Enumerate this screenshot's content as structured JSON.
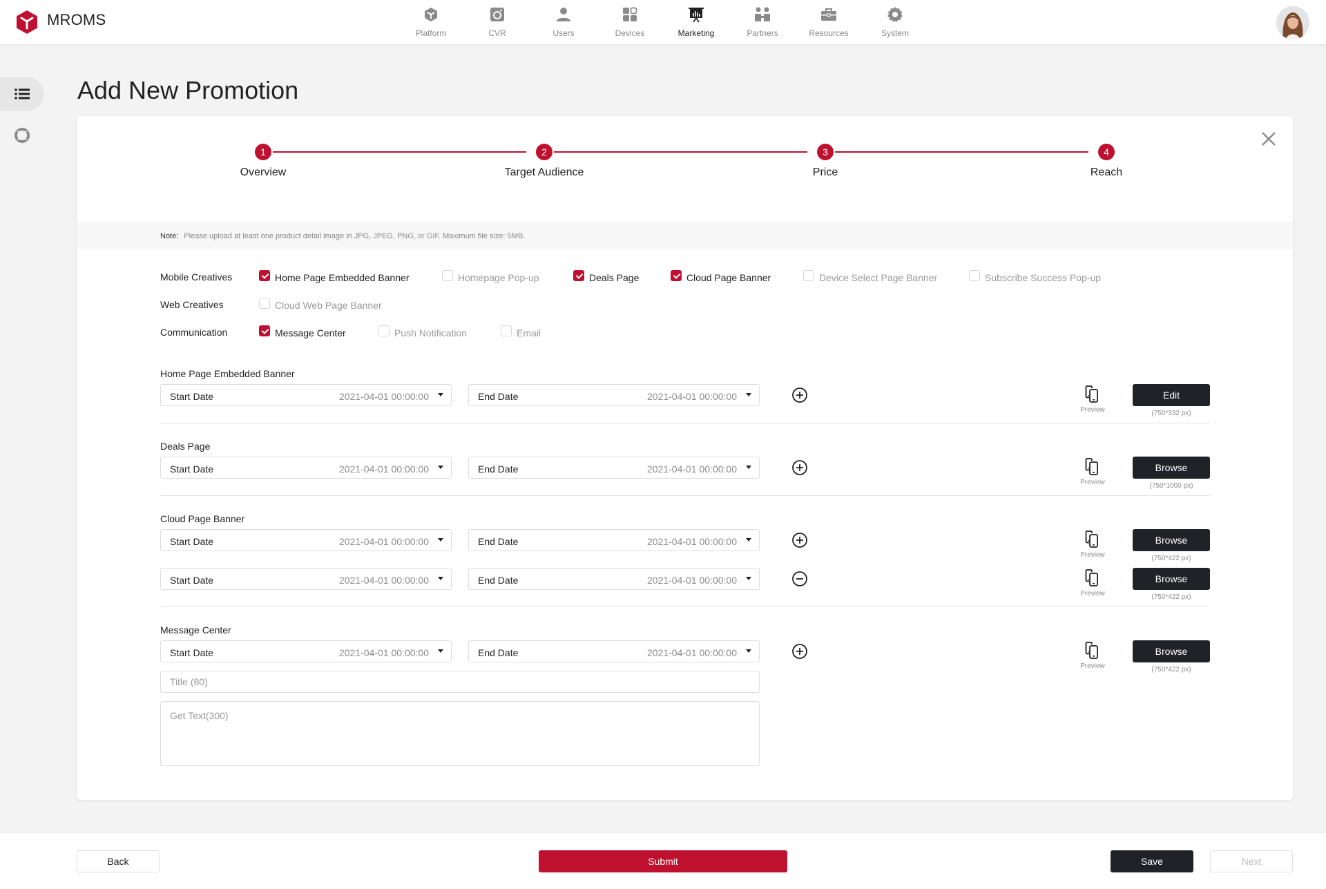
{
  "app": {
    "brand": "MROMS"
  },
  "nav": {
    "items": [
      {
        "label": "Platform",
        "icon": "cube-icon"
      },
      {
        "label": "CVR",
        "icon": "camera-icon"
      },
      {
        "label": "Users",
        "icon": "user-icon"
      },
      {
        "label": "Devices",
        "icon": "devices-grid-icon"
      },
      {
        "label": "Marketing",
        "icon": "presentation-board-icon",
        "active": true
      },
      {
        "label": "Partners",
        "icon": "partners-icon"
      },
      {
        "label": "Resources",
        "icon": "toolbox-icon"
      },
      {
        "label": "System",
        "icon": "gear-icon"
      }
    ]
  },
  "sidebar": {
    "items": [
      {
        "icon": "list-icon",
        "active": true
      },
      {
        "icon": "support-ring-icon",
        "active": false
      }
    ]
  },
  "page": {
    "title": "Add New Promotion"
  },
  "stepper": {
    "steps": [
      {
        "number": "1",
        "label": "Overview"
      },
      {
        "number": "2",
        "label": "Target Audience"
      },
      {
        "number": "3",
        "label": "Price"
      },
      {
        "number": "4",
        "label": "Reach"
      }
    ]
  },
  "note": {
    "key": "Note:",
    "text": "Please upload at least one product detail image in JPG, JPEG, PNG, or GIF.   Maximum file size: 5MB."
  },
  "creatives": {
    "mobile": {
      "label": "Mobile Creatives",
      "options": [
        {
          "label": "Home Page Embedded Banner",
          "checked": true
        },
        {
          "label": "Homepage Pop-up",
          "checked": false
        },
        {
          "label": "Deals Page",
          "checked": true
        },
        {
          "label": "Cloud Page Banner",
          "checked": true
        },
        {
          "label": "Device Select Page Banner",
          "checked": false
        },
        {
          "label": "Subscribe Success Pop-up",
          "checked": false
        }
      ]
    },
    "web": {
      "label": "Web Creatives",
      "options": [
        {
          "label": "Cloud Web Page Banner",
          "checked": false
        }
      ]
    },
    "communication": {
      "label": "Communication",
      "options": [
        {
          "label": "Message Center",
          "checked": true
        },
        {
          "label": "Push Notification",
          "checked": false
        },
        {
          "label": "Email",
          "checked": false
        }
      ]
    }
  },
  "field_labels": {
    "start": "Start Date",
    "end": "End Date",
    "preview": "Preview"
  },
  "sections": [
    {
      "title": "Home Page Embedded Banner",
      "rows": [
        {
          "start": "2021-04-01 00:00:00",
          "end": "2021-04-01 00:00:00",
          "row_action": "add",
          "button": "Edit",
          "dimensions": "(750*332 px)"
        }
      ]
    },
    {
      "title": "Deals Page",
      "rows": [
        {
          "start": "2021-04-01 00:00:00",
          "end": "2021-04-01 00:00:00",
          "row_action": "add",
          "button": "Browse",
          "dimensions": "(750*1000 px)"
        }
      ]
    },
    {
      "title": "Cloud Page Banner",
      "rows": [
        {
          "start": "2021-04-01 00:00:00",
          "end": "2021-04-01 00:00:00",
          "row_action": "add",
          "button": "Browse",
          "dimensions": "(750*422 px)"
        },
        {
          "start": "2021-04-01 00:00:00",
          "end": "2021-04-01 00:00:00",
          "row_action": "remove",
          "button": "Browse",
          "dimensions": "(750*422 px)"
        }
      ]
    },
    {
      "title": "Message Center",
      "rows": [
        {
          "start": "2021-04-01 00:00:00",
          "end": "2021-04-01 00:00:00",
          "row_action": "add",
          "button": "Browse",
          "dimensions": "(750*422 px)"
        }
      ],
      "title_placeholder": "Title (80)",
      "text_placeholder": "Get Text(300)"
    }
  ],
  "footer": {
    "back": "Back",
    "submit": "Submit",
    "save": "Save",
    "next": "Next"
  },
  "colors": {
    "accent": "#c0102f",
    "dark_button": "#1f2227",
    "background": "#f3f3f3"
  }
}
